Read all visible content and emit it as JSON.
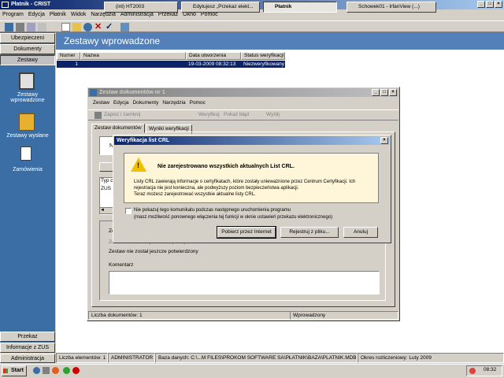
{
  "app": {
    "title": "Płatnik - CRIST"
  },
  "menu": [
    "Program",
    "Edycja",
    "Płatnik",
    "Widok",
    "Narzędzia",
    "Administracja",
    "Przekaz",
    "Okno",
    "Pomoc"
  ],
  "sidebar": {
    "top_buttons": [
      "Ubezpieczeni",
      "Dokumenty",
      "Zestawy"
    ],
    "items": [
      {
        "label": "Zestawy wprowadzone",
        "icon": "document-set-icon"
      },
      {
        "label": "Zestawy wysłane",
        "icon": "sent-sets-icon"
      },
      {
        "label": "Zamówienia",
        "icon": "orders-icon"
      }
    ],
    "bottom_buttons": [
      "Przekaz elektroniczny",
      "Informacje z ZUS",
      "Administracja"
    ]
  },
  "main": {
    "header": "Zestawy wprowadzone",
    "columns": [
      "Numer",
      "Nazwa",
      "Data utworzenia",
      "Status weryfikacji"
    ],
    "rows": [
      {
        "numer": "1",
        "nazwa": "",
        "data": "19-03-2009 08:32:13",
        "status": "Niezweryfikowany"
      }
    ]
  },
  "child": {
    "title": "Zestaw dokumentów nr 1",
    "menu": [
      "Zestaw",
      "Edycja",
      "Dokumenty",
      "Narzędzia",
      "Pomoc"
    ],
    "toolbar": {
      "save": "Zapisz i zamknij",
      "verify": "Weryfikuj",
      "show": "Pokaż błąd",
      "send": "Wyślij"
    },
    "tabs": [
      "Zestaw dokumentów",
      "Wyniki weryfikacji"
    ],
    "table_col": "Typ d",
    "table_val": "ZUS",
    "status_lines": [
      "Zestaw nie został jeszcze wysłany",
      "Zestaw nie został jeszcze potwierdzony"
    ],
    "comment_label": "Komentarz",
    "status_left": "Liczba dokumentów: 1",
    "status_right": "Wprowadzony",
    "truncated": {
      "n1": "N",
      "zes1": "Zes"
    }
  },
  "dialog": {
    "title": "Weryfikacja list CRL",
    "heading": "Nie zarejestrowano wszystkich aktualnych List CRL.",
    "body1": "Listy CRL zawierają informacje o certyfikatach, które zostały unieważnione przez Centrum Certyfikacji. Ich rejestracja nie jest konieczna, ale podwyższy poziom bezpieczeństwa aplikacji.",
    "body2": "Teraz możesz zarejestrować wszystkie aktualne listy CRL.",
    "checkbox": "Nie pokazuj tego komunikatu podczas następnego uruchomienia programu",
    "checkbox_note": "(masz możliwość ponownego włączenia tej funkcji w oknie ustawień przekazu elektronicznego)",
    "btn_download": "Pobierz przez Internet",
    "btn_register": "Rejestruj z pliku...",
    "btn_cancel": "Anuluj"
  },
  "statusbar": {
    "count": "Liczba elementów: 1",
    "user": "ADMINISTRATOR",
    "db": "Baza danych: C:\\...M FILES\\PROKOM SOFTWARE SA\\PŁATNIK\\BAZA\\PLATNIK.MDB",
    "period": "Okres rozliczeniowy: Luty 2009"
  },
  "taskbar": {
    "start": "Start",
    "tasks": [
      "(int) HT2003",
      "Edytujesz „Przekaz elekt...",
      "Płatnik",
      "Schowek01 - IrfanView (...)"
    ],
    "clock": "08:32"
  },
  "colors": {
    "sidebar": "#3a6ea5",
    "header": "#5380b9",
    "selection": "#0a246a",
    "dialog_panel": "#fff5d8"
  }
}
